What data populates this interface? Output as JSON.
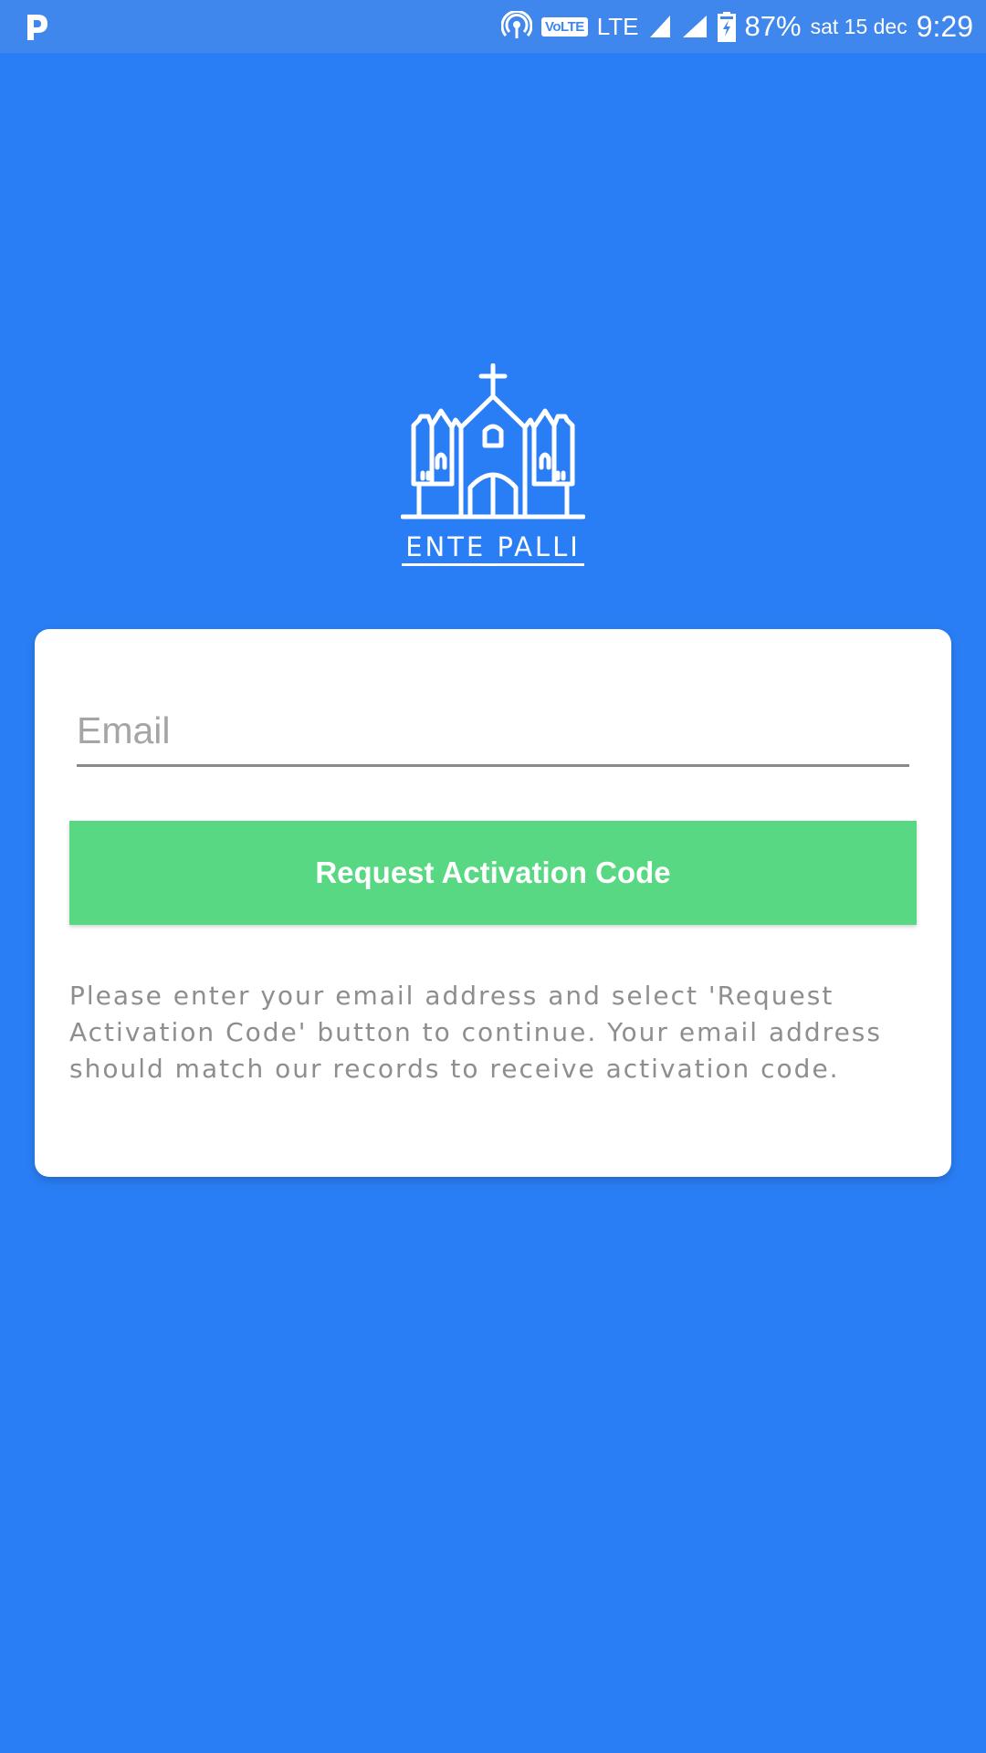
{
  "status_bar": {
    "app_icon": "p-icon",
    "icons": [
      "hotspot-icon",
      "volte-icon",
      "signal-icon",
      "signal-icon",
      "battery-charging-icon"
    ],
    "volte": "VoLTE",
    "network": "LTE",
    "battery": "87%",
    "date": "sat 15 dec",
    "time": "9:29"
  },
  "logo": {
    "icon": "church-icon",
    "text": "ENTE PALLI"
  },
  "form": {
    "email_placeholder": "Email",
    "email_value": "",
    "button_label": "Request Activation Code",
    "help_text": "Please enter your email address and select 'Request Activation Code' button to continue. Your email address should match our records to receive activation code."
  },
  "colors": {
    "background": "#2a7ef5",
    "status_bar": "#3f87ec",
    "button": "#58d883",
    "card": "#ffffff",
    "help_text": "#8e8e8e"
  }
}
